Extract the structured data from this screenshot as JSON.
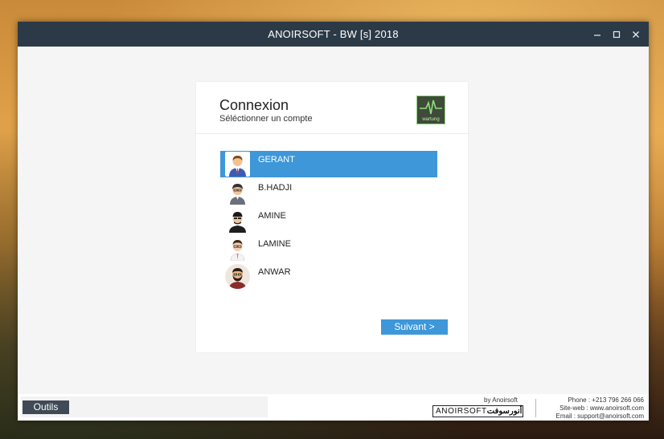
{
  "window": {
    "title": "ANOIRSOFT - BW [s] 2018"
  },
  "login": {
    "title": "Connexion",
    "subtitle": "Séléctionner un compte",
    "logo_label": "wartung",
    "accounts": [
      {
        "name": "GERANT",
        "selected": true
      },
      {
        "name": "B.HADJI",
        "selected": false
      },
      {
        "name": "AMINE",
        "selected": false
      },
      {
        "name": "LAMINE",
        "selected": false
      },
      {
        "name": "ANWAR",
        "selected": false
      }
    ],
    "next_label": "Suivant >"
  },
  "footer": {
    "tools_label": "Outils",
    "by_label": "by Anoirsoft",
    "brand_latin": "ANOIRSOFT",
    "brand_arabic": "أنورسوفت",
    "phone": "Phone : +213 796 266 066",
    "website": "Site-web : www.anoirsoft.com",
    "email": "Email : support@anoirsoft.com"
  },
  "colors": {
    "titlebar": "#2c3a47",
    "accent": "#3d97d8",
    "tools_button": "#3f4a56"
  }
}
